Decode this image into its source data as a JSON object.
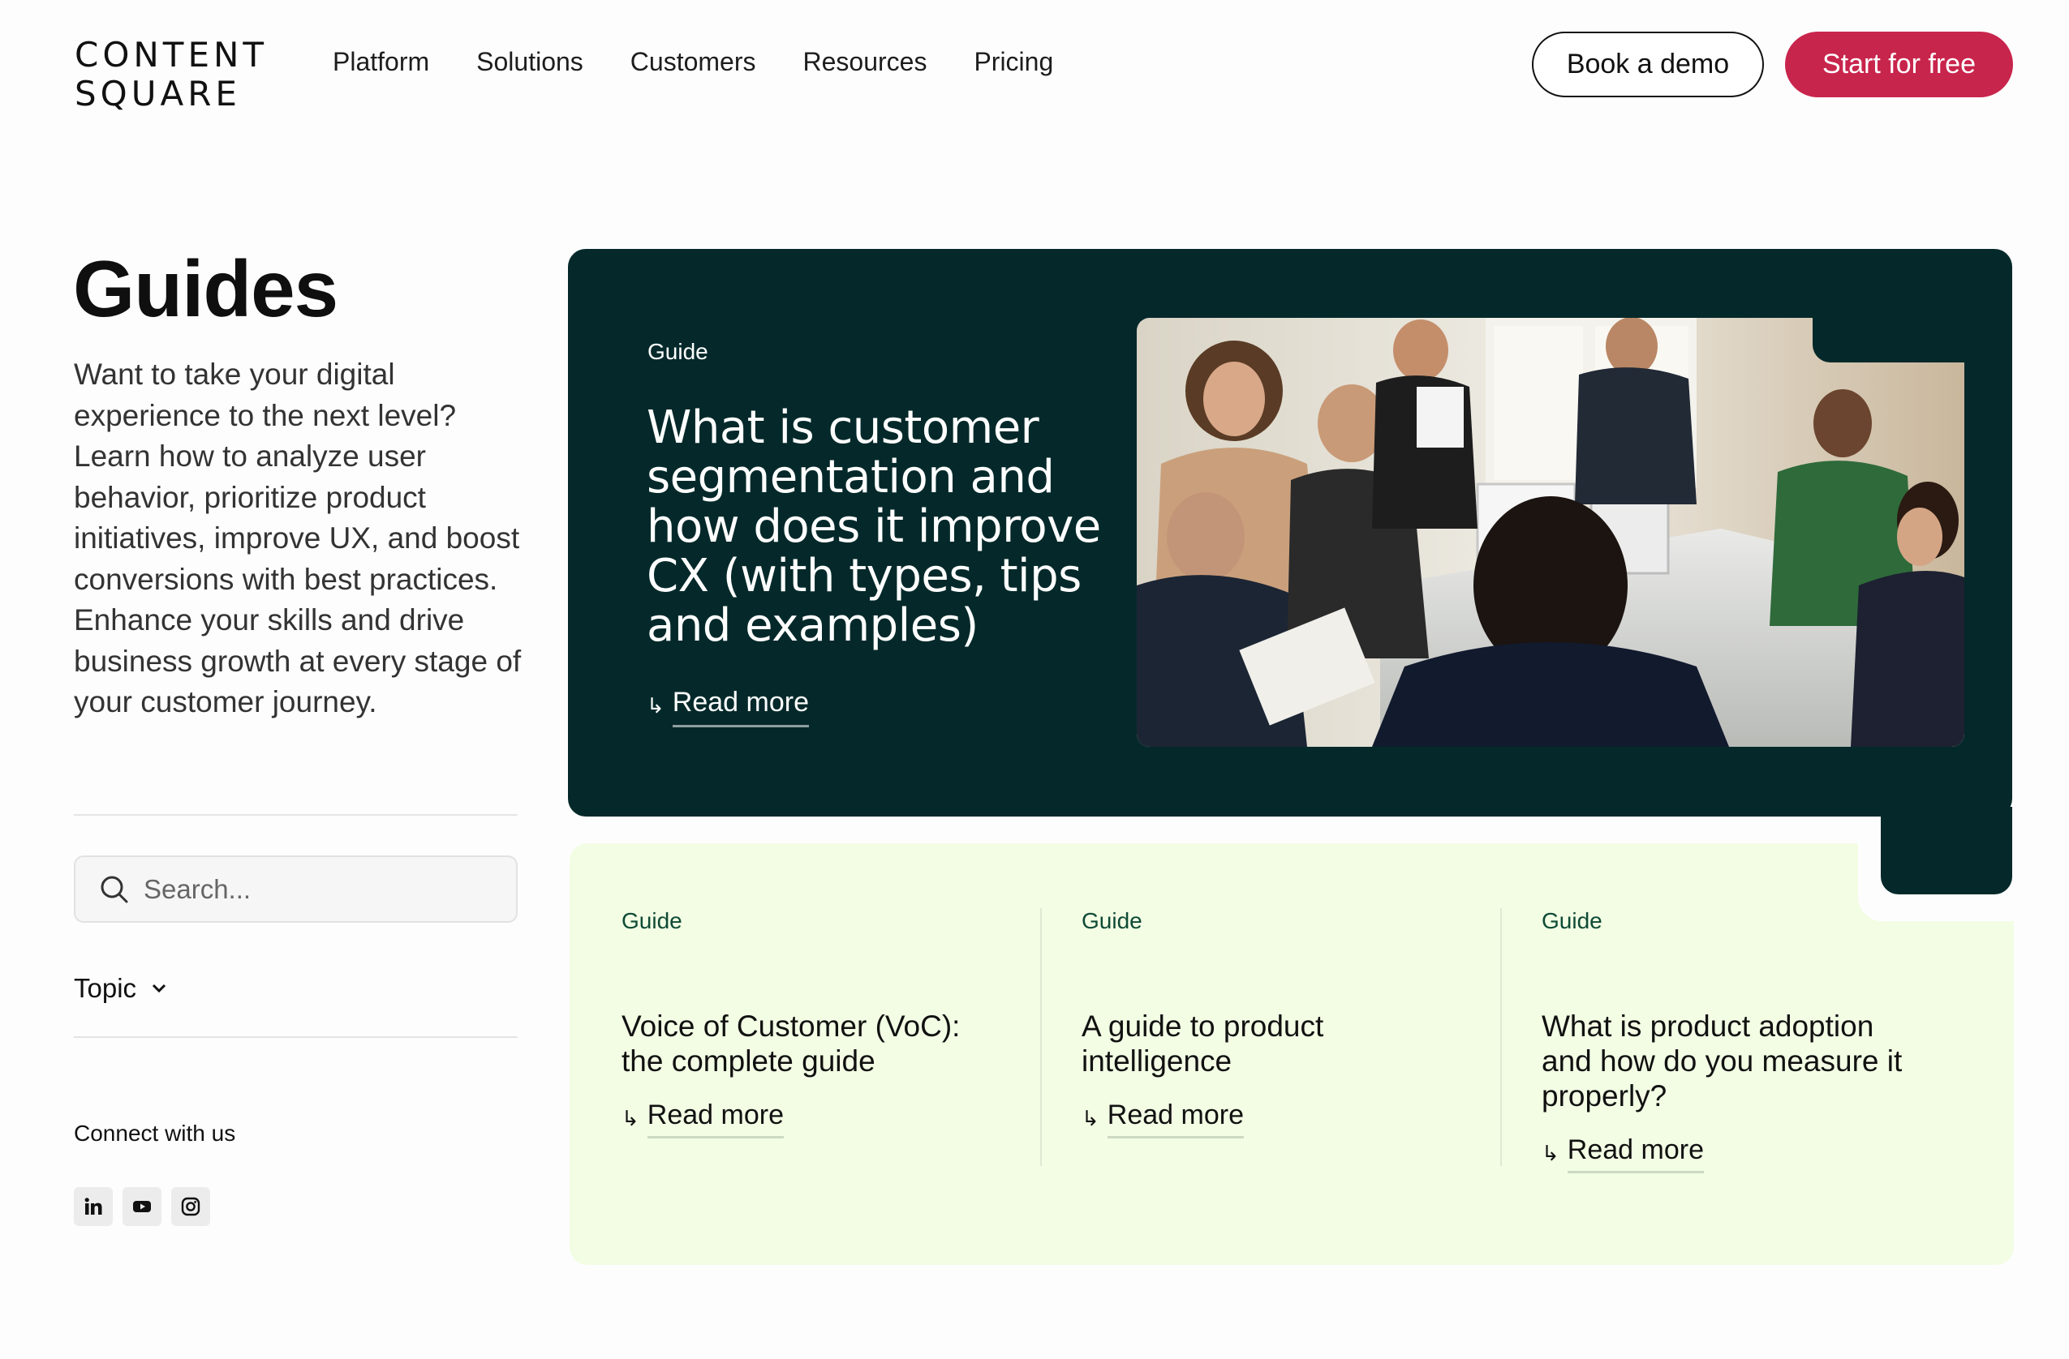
{
  "header": {
    "logo": {
      "line1": "CONTENT",
      "line2": "SQUARE"
    },
    "nav": [
      "Platform",
      "Solutions",
      "Customers",
      "Resources",
      "Pricing"
    ],
    "book_demo": "Book a demo",
    "start_free": "Start for free"
  },
  "sidebar": {
    "title": "Guides",
    "intro": "Want to take your digital experience to the next level? Learn how to analyze user behavior, prioritize product initiatives, improve UX, and boost conversions with best practices. Enhance your skills and drive business growth at every stage of your customer journey.",
    "search_placeholder": "Search...",
    "topic": "Topic",
    "connect": "Connect with us",
    "socials": [
      "linkedin-icon",
      "youtube-icon",
      "instagram-icon"
    ]
  },
  "featured": {
    "tag": "Guide",
    "title": "What is customer segmentation and how does it improve CX (with types, tips and examples)",
    "read_more": "Read more",
    "arrow": "↳"
  },
  "cards": [
    {
      "tag": "Guide",
      "title": "Voice of Customer (VoC): the complete guide",
      "read_more": "Read more"
    },
    {
      "tag": "Guide",
      "title": "A guide to product intelligence",
      "read_more": "Read more"
    },
    {
      "tag": "Guide",
      "title": "What is product adoption and how do you measure it properly?",
      "read_more": "Read more"
    }
  ],
  "colors": {
    "accent": "#c8254c",
    "featured_bg": "#05292a",
    "cards_bg": "#f2fde4",
    "tag_green": "#0e4a35"
  }
}
